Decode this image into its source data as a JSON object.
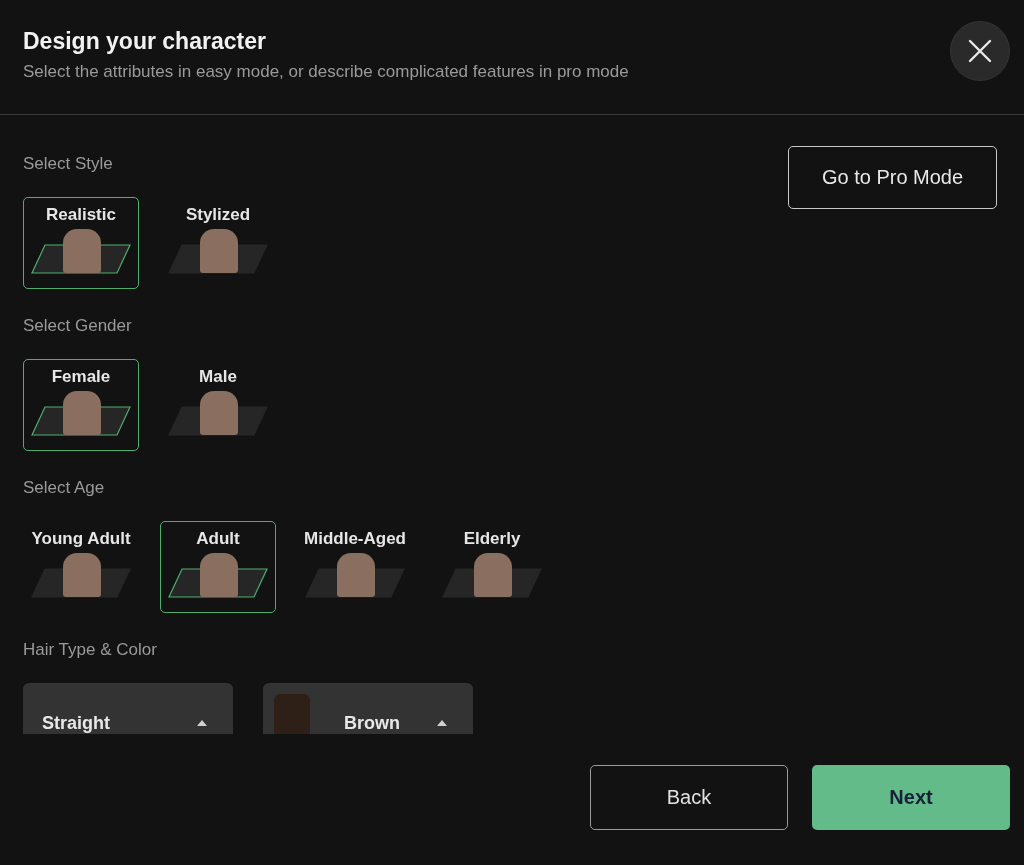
{
  "dialog": {
    "title": "Design your character",
    "subtitle": "Select the attributes in easy mode, or describe complicated features in pro mode"
  },
  "pro_mode_button": "Go to Pro Mode",
  "sections": [
    {
      "label": "Select Style",
      "kind": "options",
      "options": [
        {
          "label": "Realistic",
          "selected": true
        },
        {
          "label": "Stylized",
          "selected": false
        }
      ]
    },
    {
      "label": "Select Gender",
      "kind": "options",
      "options": [
        {
          "label": "Female",
          "selected": true
        },
        {
          "label": "Male",
          "selected": false
        }
      ]
    },
    {
      "label": "Select Age",
      "kind": "options",
      "options": [
        {
          "label": "Young Adult",
          "selected": false
        },
        {
          "label": "Adult",
          "selected": true
        },
        {
          "label": "Middle-Aged",
          "selected": false
        },
        {
          "label": "Elderly",
          "selected": false
        }
      ]
    },
    {
      "label": "Hair Type & Color",
      "kind": "dropdowns",
      "dropdowns": [
        {
          "value": "Straight"
        },
        {
          "value": "Brown",
          "color": "#2e1f17"
        }
      ]
    }
  ],
  "buttons": {
    "back": "Back",
    "next": "Next"
  }
}
